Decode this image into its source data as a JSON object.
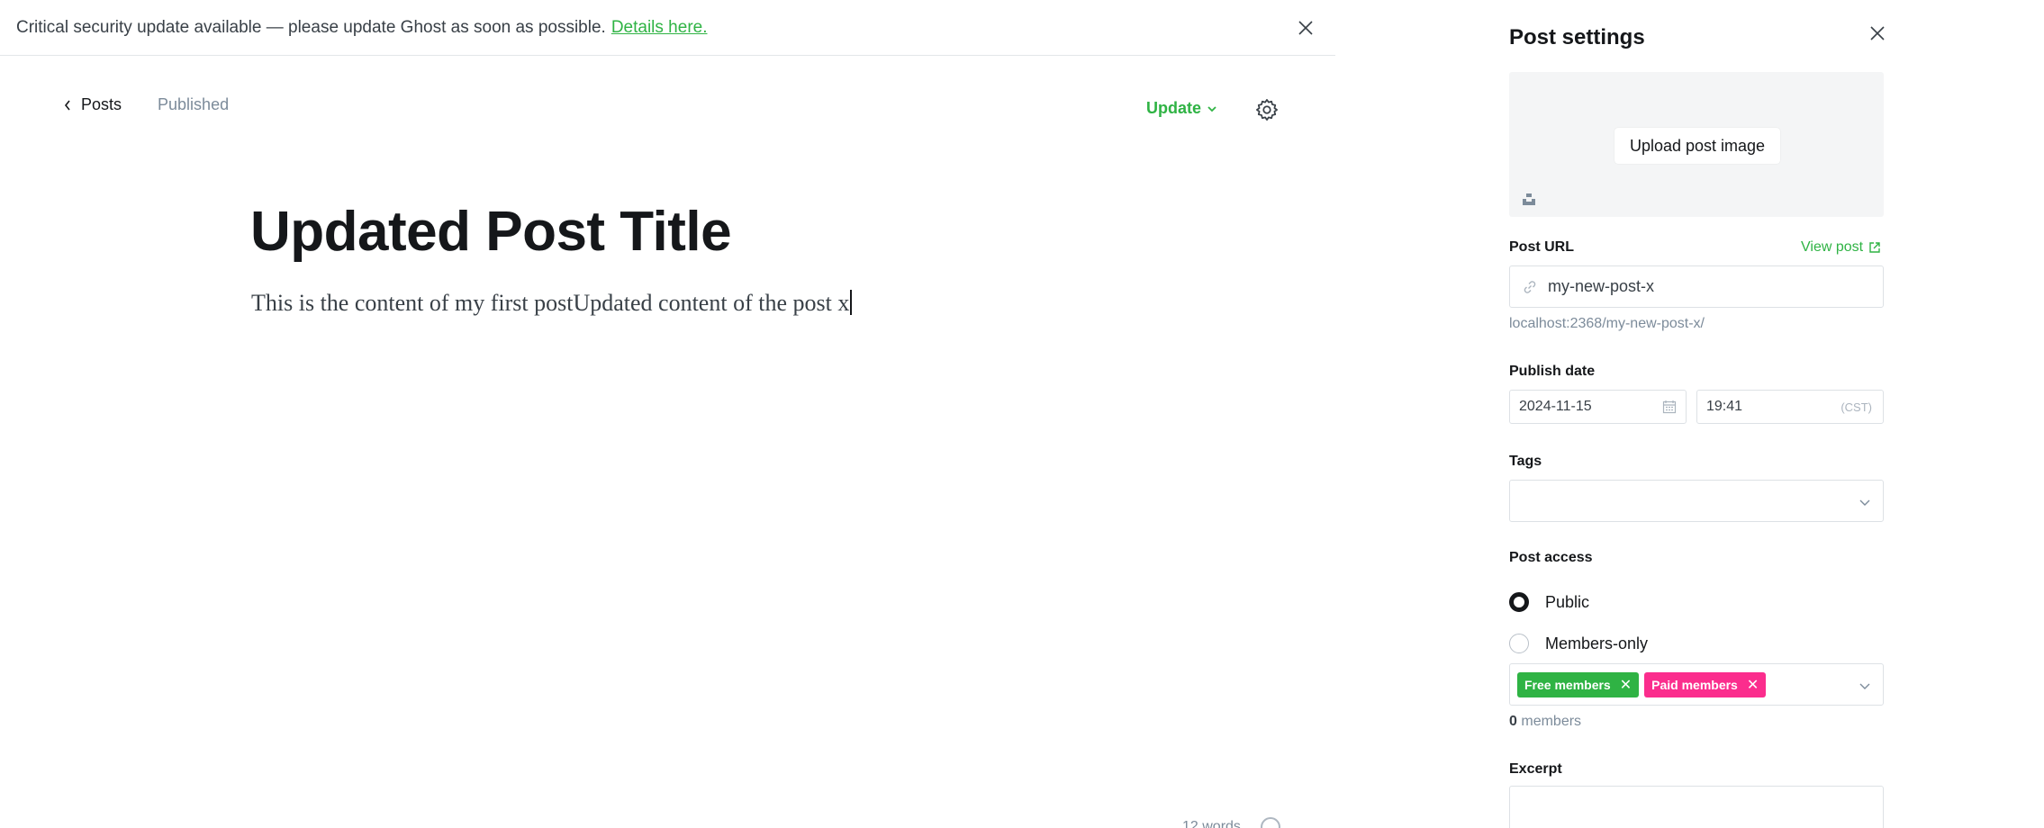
{
  "alert": {
    "message": "Critical security update available — please update Ghost as soon as possible.",
    "link_text": "Details here."
  },
  "nav": {
    "back_label": "Posts",
    "status": "Published",
    "update_label": "Update"
  },
  "editor": {
    "title": "Updated Post Title",
    "body": "This is the content of my first postUpdated content of the post x",
    "word_count": "12 words"
  },
  "settings": {
    "title": "Post settings",
    "upload_image_label": "Upload post image",
    "post_url": {
      "label": "Post URL",
      "view_post_label": "View post",
      "value": "my-new-post-x",
      "hint": "localhost:2368/my-new-post-x/"
    },
    "publish_date": {
      "label": "Publish date",
      "date": "2024-11-15",
      "time": "19:41",
      "timezone": "(CST)"
    },
    "tags": {
      "label": "Tags",
      "value": ""
    },
    "post_access": {
      "label": "Post access",
      "options": [
        {
          "label": "Public",
          "selected": true
        },
        {
          "label": "Members-only",
          "selected": false
        }
      ],
      "segments": [
        {
          "label": "Free members",
          "color": "#2fb344"
        },
        {
          "label": "Paid members",
          "color": "#fb2d8d"
        }
      ],
      "members_count": "0",
      "members_suffix": "members"
    },
    "excerpt": {
      "label": "Excerpt",
      "value": ""
    }
  },
  "colors": {
    "accent_green": "#2fb344",
    "paid_pink": "#fb2d8d",
    "text_dark": "#15171a",
    "text_muted": "#7c8b9a"
  }
}
